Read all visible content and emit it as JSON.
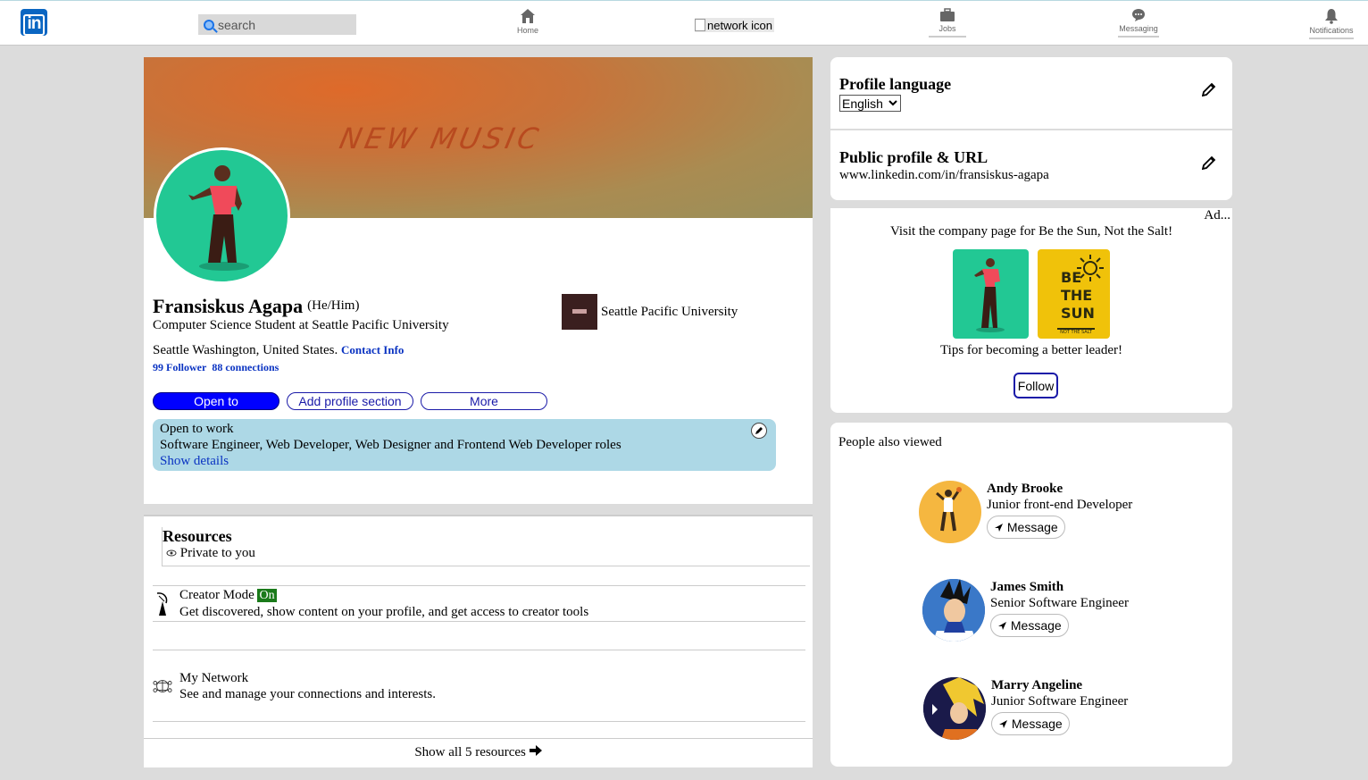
{
  "nav": {
    "search_placeholder": "search",
    "home_label": "Home",
    "network_alt": "network icon",
    "jobs_label": "Jobs",
    "messaging_label": "Messaging",
    "notifications_label": "Notifications",
    "logo_text": "in"
  },
  "profile": {
    "banner_text": "NEW MUSIC",
    "name": "Fransiskus Agapa",
    "pronouns": "(He/Him)",
    "headline": "Computer Science Student at Seattle Pacific University",
    "location": "Seattle Washington, United States.",
    "contact_info": "Contact Info",
    "followers": "99 Follower",
    "connections": "88 connections",
    "school": "Seattle Pacific University",
    "buttons": {
      "open_to": "Open to",
      "add_section": "Add profile section",
      "more": "More"
    },
    "open_to_work": {
      "title": "Open to work",
      "roles": "Software Engineer, Web Developer, Web Designer and Frontend Web Developer roles",
      "show_details": "Show details"
    }
  },
  "resources": {
    "title": "Resources",
    "privacy": "Private to you",
    "items": [
      {
        "title": "Creator Mode",
        "badge": "On",
        "desc": "Get discovered, show content on your profile, and get access to creator tools"
      },
      {
        "title": "My Network",
        "desc": "See and manage your connections and interests."
      }
    ],
    "show_all": "Show all 5 resources"
  },
  "sidebar": {
    "language": {
      "title": "Profile language",
      "selected": "English"
    },
    "public_url": {
      "title": "Public profile & URL",
      "url": "www.linkedin.com/in/fransiskus-agapa"
    },
    "ad": {
      "label": "Ad...",
      "text": "Visit the company page for Be the Sun, Not the Salt!",
      "tagline": "Tips for becoming a better leader!",
      "follow": "Follow",
      "brand_lines": [
        "BE",
        "THE",
        "SUN",
        "NOT THE SALT"
      ]
    },
    "people_also_viewed": {
      "title": "People also viewed",
      "message_label": "Message",
      "people": [
        {
          "name": "Andy Brooke",
          "role": "Junior front-end Developer"
        },
        {
          "name": "James Smith",
          "role": "Senior Software Engineer"
        },
        {
          "name": "Marry Angeline",
          "role": "Junior Software Engineer"
        }
      ]
    }
  }
}
